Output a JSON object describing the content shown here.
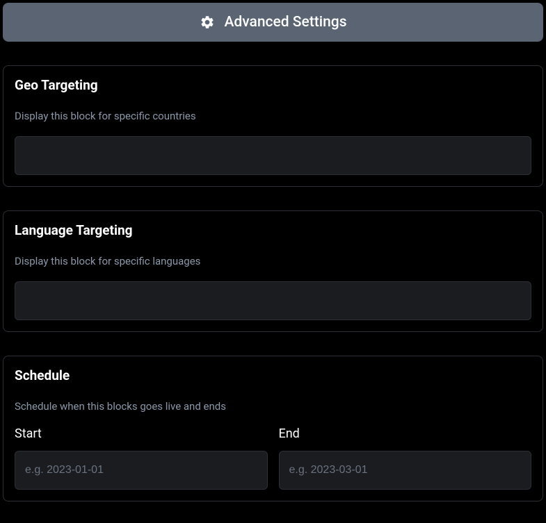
{
  "header": {
    "title": "Advanced Settings"
  },
  "sections": {
    "geo": {
      "title": "Geo Targeting",
      "description": "Display this block for specific countries"
    },
    "language": {
      "title": "Language Targeting",
      "description": "Display this block for specific languages"
    },
    "schedule": {
      "title": "Schedule",
      "description": "Schedule when this blocks goes live and ends",
      "start": {
        "label": "Start",
        "placeholder": "e.g. 2023-01-01",
        "value": ""
      },
      "end": {
        "label": "End",
        "placeholder": "e.g. 2023-03-01",
        "value": ""
      }
    }
  }
}
